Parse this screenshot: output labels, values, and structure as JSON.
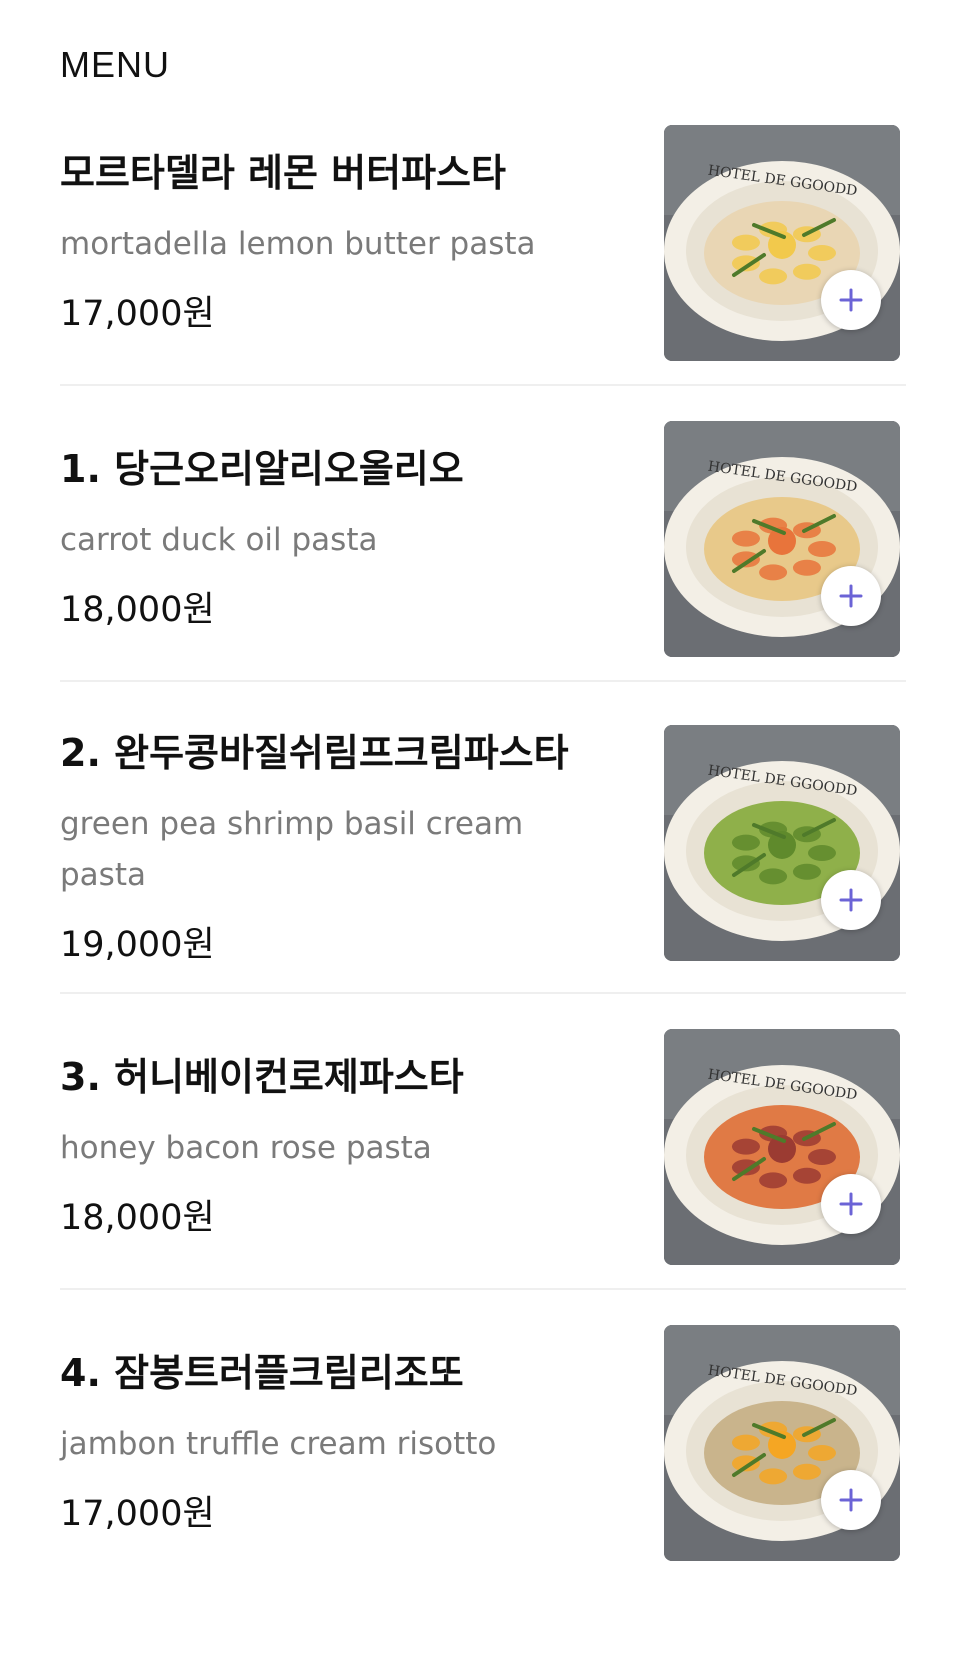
{
  "header": {
    "title": "MENU"
  },
  "items": [
    {
      "name": "모르타델라 레몬 버터파스타",
      "desc": "mortadella lemon butter pasta",
      "price": "17,000원",
      "plate_text": "HOTEL DE GGOODD",
      "sauce_color": "#e9d6b4",
      "topping_color": "#f2c94c"
    },
    {
      "name": "1. 당근오리알리오올리오",
      "desc": "carrot duck oil pasta",
      "price": "18,000원",
      "plate_text": "HOTEL DE GGOODD",
      "sauce_color": "#e8c98a",
      "topping_color": "#e8743b"
    },
    {
      "name": "2. 완두콩바질쉬림프크림파스타",
      "desc": "green pea shrimp basil cream pasta",
      "price": "19,000원",
      "plate_text": "HOTEL DE GGOODD",
      "sauce_color": "#8fb04a",
      "topping_color": "#5f8a2c"
    },
    {
      "name": "3. 허니베이컨로제파스타",
      "desc": "honey bacon rose pasta",
      "price": "18,000원",
      "plate_text": "HOTEL DE GGOODD",
      "sauce_color": "#e07a45",
      "topping_color": "#9b3b32"
    },
    {
      "name": "4. 잠봉트러플크림리조또",
      "desc": "jambon truffle cream risotto",
      "price": "17,000원",
      "plate_text": "HOTEL DE GGOODD",
      "sauce_color": "#c9b48c",
      "topping_color": "#f5a623"
    }
  ],
  "colors": {
    "accent": "#6b63d6",
    "divider": "#efefef"
  },
  "icons": {
    "add": "plus-icon"
  }
}
